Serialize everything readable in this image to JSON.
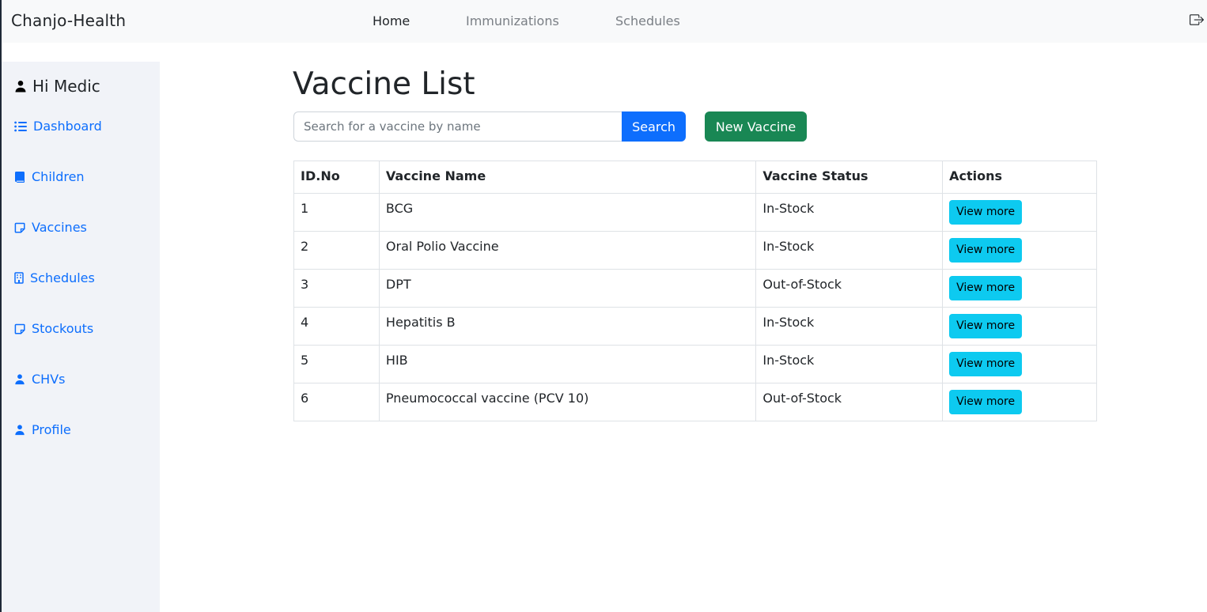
{
  "app": {
    "brand": "Chanjo-Health"
  },
  "topnav": {
    "items": [
      {
        "label": "Home"
      },
      {
        "label": "Immunizations"
      },
      {
        "label": "Schedules"
      }
    ],
    "logout_icon": "logout-icon"
  },
  "sidebar": {
    "greeting": "Hi Medic",
    "greeting_icon": "person-icon",
    "items": [
      {
        "label": "Dashboard",
        "icon": "list-icon"
      },
      {
        "label": "Children",
        "icon": "book-icon"
      },
      {
        "label": "Vaccines",
        "icon": "sticky-note-icon"
      },
      {
        "label": "Schedules",
        "icon": "building-icon"
      },
      {
        "label": "Stockouts",
        "icon": "sticky-note-icon"
      },
      {
        "label": "CHVs",
        "icon": "person-icon"
      },
      {
        "label": "Profile",
        "icon": "person-icon"
      }
    ]
  },
  "main": {
    "title": "Vaccine List",
    "search": {
      "placeholder": "Search for a vaccine by name",
      "value": "",
      "button_label": "Search"
    },
    "new_button_label": "New Vaccine",
    "table": {
      "headers": [
        "ID.No",
        "Vaccine Name",
        "Vaccine Status",
        "Actions"
      ],
      "rows": [
        {
          "id": "1",
          "name": "BCG",
          "status": "In-Stock",
          "action": "View more"
        },
        {
          "id": "2",
          "name": "Oral Polio Vaccine",
          "status": "In-Stock",
          "action": "View more"
        },
        {
          "id": "3",
          "name": "DPT",
          "status": "Out-of-Stock",
          "action": "View more"
        },
        {
          "id": "4",
          "name": "Hepatitis B",
          "status": "In-Stock",
          "action": "View more"
        },
        {
          "id": "5",
          "name": "HIB",
          "status": "In-Stock",
          "action": "View more"
        },
        {
          "id": "6",
          "name": "Pneumococcal vaccine (PCV 10)",
          "status": "Out-of-Stock",
          "action": "View more"
        }
      ]
    }
  },
  "colors": {
    "primary": "#0d6efd",
    "success": "#198754",
    "info": "#0dcaf0",
    "sidebar_bg": "#f1f3f8",
    "navbar_bg": "#f8f9fa"
  }
}
